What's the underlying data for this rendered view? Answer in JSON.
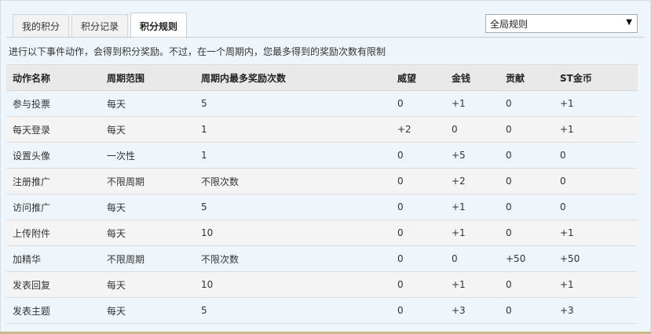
{
  "tabs": [
    {
      "label": "我的积分",
      "active": false
    },
    {
      "label": "积分记录",
      "active": false
    },
    {
      "label": "积分规则",
      "active": true
    }
  ],
  "scope_select": {
    "selected": "全局规则"
  },
  "description": "进行以下事件动作，会得到积分奖励。不过，在一个周期内，您最多得到的奖励次数有限制",
  "table": {
    "headers": [
      "动作名称",
      "周期范围",
      "周期内最多奖励次数",
      "威望",
      "金钱",
      "贡献",
      "ST金币"
    ],
    "rows": [
      [
        "参与投票",
        "每天",
        "5",
        "0",
        "+1",
        "0",
        "+1"
      ],
      [
        "每天登录",
        "每天",
        "1",
        "+2",
        "0",
        "0",
        "+1"
      ],
      [
        "设置头像",
        "一次性",
        "1",
        "0",
        "+5",
        "0",
        "0"
      ],
      [
        "注册推广",
        "不限周期",
        "不限次数",
        "0",
        "+2",
        "0",
        "0"
      ],
      [
        "访问推广",
        "每天",
        "5",
        "0",
        "+1",
        "0",
        "0"
      ],
      [
        "上传附件",
        "每天",
        "10",
        "0",
        "+1",
        "0",
        "+1"
      ],
      [
        "加精华",
        "不限周期",
        "不限次数",
        "0",
        "0",
        "+50",
        "+50"
      ],
      [
        "发表回复",
        "每天",
        "10",
        "0",
        "+1",
        "0",
        "+1"
      ],
      [
        "发表主题",
        "每天",
        "5",
        "0",
        "+3",
        "0",
        "+3"
      ]
    ]
  }
}
